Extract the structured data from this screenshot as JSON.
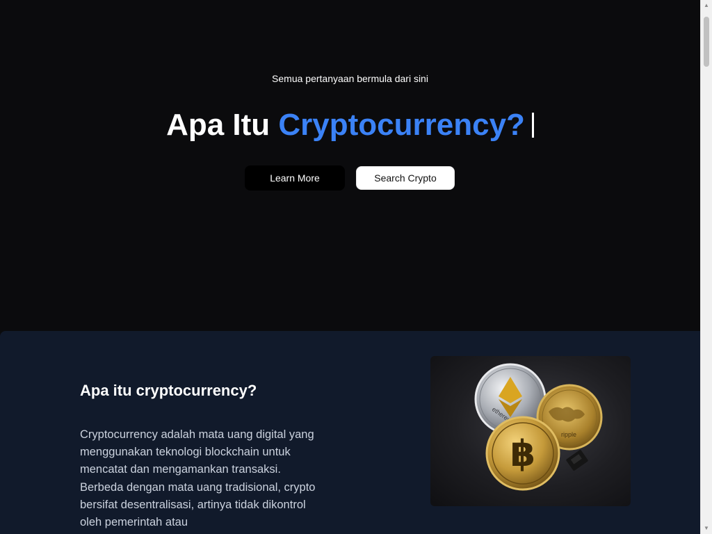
{
  "hero": {
    "tagline": "Semua pertanyaan bermula dari sini",
    "title_prefix": "Apa Itu ",
    "title_highlight": "Cryptocurrency?",
    "accent_color": "#3b82f6",
    "learn_more_label": "Learn More",
    "search_crypto_label": "Search Crypto"
  },
  "about": {
    "heading": "Apa itu cryptocurrency?",
    "body": "Cryptocurrency adalah mata uang digital yang menggunakan teknologi blockchain untuk mencatat dan mengamankan transaksi. Berbeda dengan mata uang tradisional, crypto bersifat desentralisasi, artinya tidak dikontrol oleh pemerintah atau",
    "image_coin_labels": {
      "ethereum": "ethereum",
      "ripple": "ripple"
    }
  },
  "scrollbar": {
    "up_icon": "scroll-up-arrow-icon",
    "down_icon": "scroll-down-arrow-icon"
  }
}
